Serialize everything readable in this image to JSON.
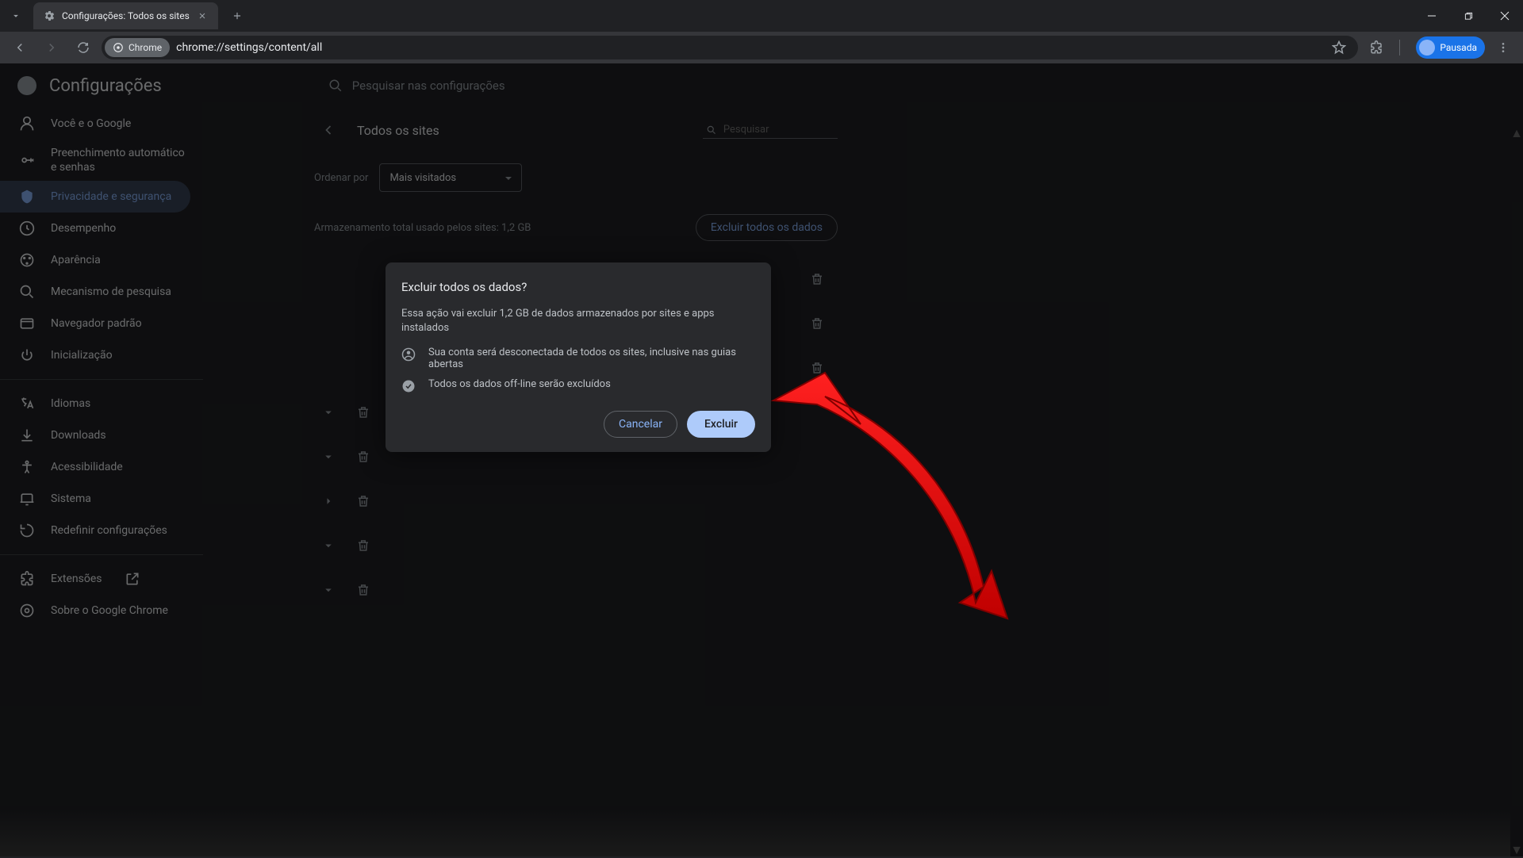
{
  "tab": {
    "title": "Configurações: Todos os sites"
  },
  "toolbar": {
    "chrome_chip": "Chrome",
    "url": "chrome://settings/content/all",
    "profile_status": "Pausada"
  },
  "settings": {
    "title": "Configurações",
    "search_placeholder": "Pesquisar nas configurações"
  },
  "sidebar": {
    "items": [
      "Você e o Google",
      "Preenchimento automático e senhas",
      "Privacidade e segurança",
      "Desempenho",
      "Aparência",
      "Mecanismo de pesquisa",
      "Navegador padrão",
      "Inicialização"
    ],
    "items2": [
      "Idiomas",
      "Downloads",
      "Acessibilidade",
      "Sistema",
      "Redefinir configurações"
    ],
    "items3": [
      "Extensões",
      "Sobre o Google Chrome"
    ]
  },
  "panel": {
    "title": "Todos os sites",
    "search_placeholder": "Pesquisar",
    "sort_label": "Ordenar por",
    "sort_value": "Mais visitados",
    "storage_text": "Armazenamento total usado pelos sites: 1,2 GB",
    "delete_all": "Excluir todos os dados"
  },
  "modal": {
    "title": "Excluir todos os dados?",
    "description": "Essa ação vai excluir 1,2 GB de dados armazenados por sites e apps instalados",
    "item1": "Sua conta será desconectada de todos os sites, inclusive nas guias abertas",
    "item2": "Todos os dados off-line serão excluídos",
    "cancel": "Cancelar",
    "confirm": "Excluir"
  }
}
